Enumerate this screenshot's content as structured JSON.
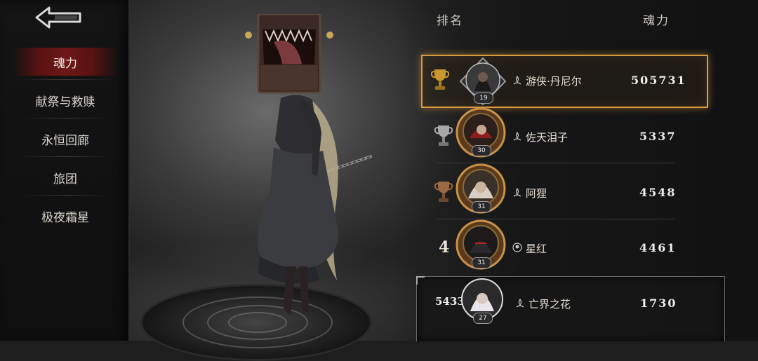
{
  "nav": {
    "back_icon": "back-arrow-icon",
    "items": [
      {
        "label": "魂力",
        "active": true
      },
      {
        "label": "献祭与救赎",
        "active": false
      },
      {
        "label": "永恒回廊",
        "active": false
      },
      {
        "label": "旅团",
        "active": false
      },
      {
        "label": "极夜霜星",
        "active": false
      }
    ]
  },
  "leaderboard": {
    "rank_header": "排名",
    "score_header": "魂力",
    "rows": [
      {
        "rank_icon": "gold-trophy-icon",
        "level": "19",
        "name": "游侠·丹尼尔",
        "score": "505731",
        "highlighted": true
      },
      {
        "rank_icon": "silver-trophy-icon",
        "level": "30",
        "name": "佐天泪子",
        "score": "5337"
      },
      {
        "rank_icon": "bronze-trophy-icon",
        "level": "31",
        "name": "阿狸",
        "score": "4548"
      },
      {
        "rank": "4",
        "level": "31",
        "name": "星红",
        "score": "4461"
      }
    ],
    "player": {
      "rank": "5433",
      "level": "27",
      "name": "亡界之花",
      "score": "1730"
    }
  },
  "colors": {
    "accent": "#d89a3e",
    "active_nav": "#6e1717"
  }
}
